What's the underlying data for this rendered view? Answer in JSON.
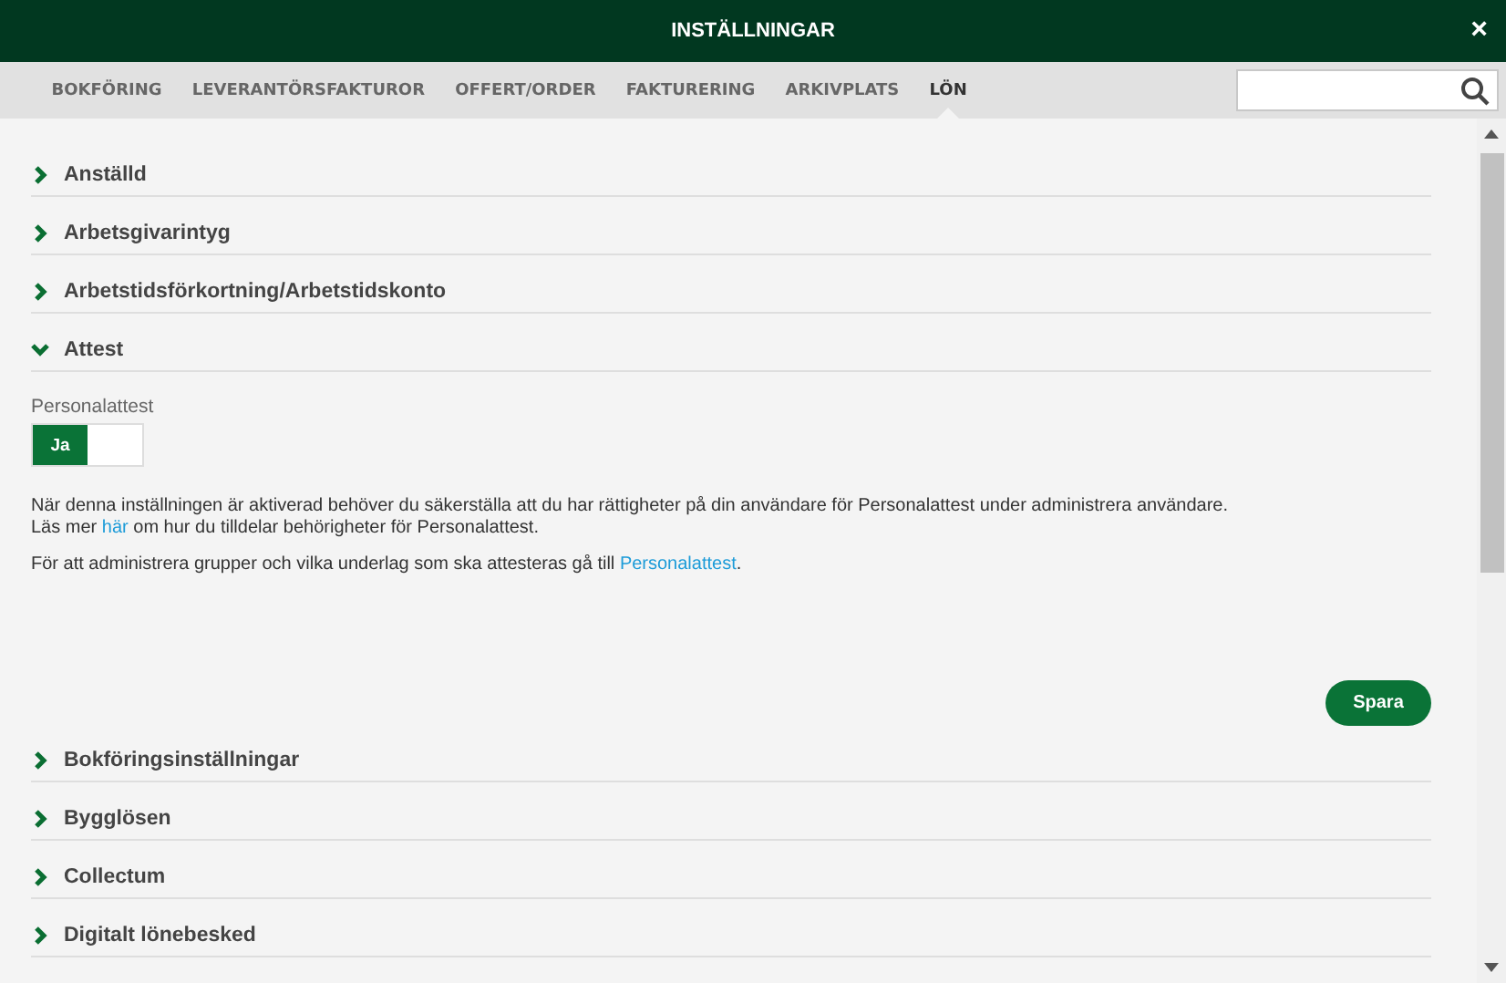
{
  "window": {
    "title": "INSTÄLLNINGAR",
    "close": "×"
  },
  "tabs": [
    {
      "label": "BOKFÖRING",
      "selected": false
    },
    {
      "label": "LEVERANTÖRSFAKTUROR",
      "selected": false
    },
    {
      "label": "OFFERT/ORDER",
      "selected": false
    },
    {
      "label": "FAKTURERING",
      "selected": false
    },
    {
      "label": "ARKIVPLATS",
      "selected": false
    },
    {
      "label": "LÖN",
      "selected": true
    }
  ],
  "sections": [
    {
      "title": "Anställd",
      "expanded": false
    },
    {
      "title": "Arbetsgivarintyg",
      "expanded": false
    },
    {
      "title": "Arbetstidsförkortning/Arbetstidskonto",
      "expanded": false
    },
    {
      "title": "Attest",
      "expanded": true,
      "toggle": {
        "label": "Personalattest",
        "on": true,
        "on_label": "Ja"
      },
      "paragraphs": [
        [
          {
            "kind": "text",
            "text": "När denna inställningen är aktiverad behöver du säkerställa att du har rättigheter på din användare för Personalattest under administrera användare."
          },
          {
            "kind": "break"
          },
          {
            "kind": "text",
            "text": "Läs mer "
          },
          {
            "kind": "link",
            "text": "här"
          },
          {
            "kind": "text",
            "text": " om hur du tilldelar behörigheter för Personalattest."
          }
        ],
        [
          {
            "kind": "text",
            "text": "För att administrera grupper och vilka underlag som ska attesteras gå till "
          },
          {
            "kind": "link",
            "text": "Personalattest"
          },
          {
            "kind": "text",
            "text": "."
          }
        ]
      ],
      "button": "Spara"
    },
    {
      "title": "Bokföringsinställningar",
      "expanded": false
    },
    {
      "title": "Bygglösen",
      "expanded": false
    },
    {
      "title": "Collectum",
      "expanded": false
    },
    {
      "title": "Digitalt lönebesked",
      "expanded": false
    }
  ]
}
